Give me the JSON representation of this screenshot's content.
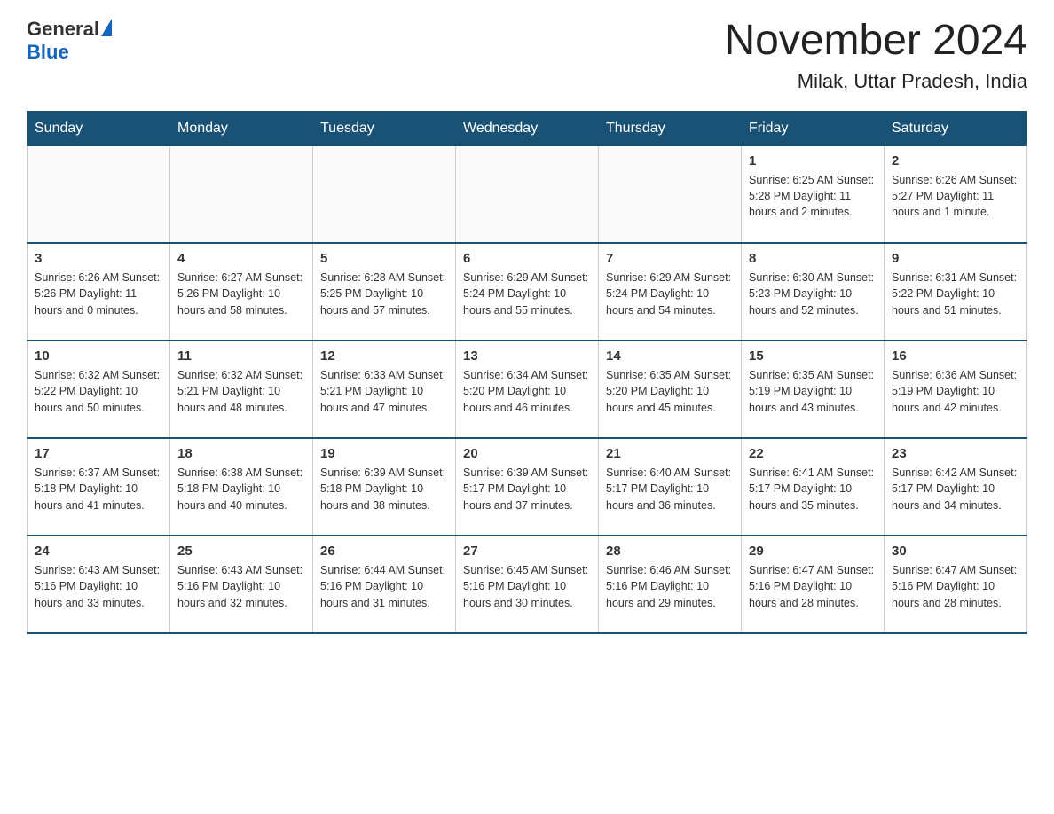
{
  "header": {
    "logo_general": "General",
    "logo_blue": "Blue",
    "month_title": "November 2024",
    "location": "Milak, Uttar Pradesh, India"
  },
  "days_of_week": [
    "Sunday",
    "Monday",
    "Tuesday",
    "Wednesday",
    "Thursday",
    "Friday",
    "Saturday"
  ],
  "weeks": [
    [
      {
        "day": "",
        "info": ""
      },
      {
        "day": "",
        "info": ""
      },
      {
        "day": "",
        "info": ""
      },
      {
        "day": "",
        "info": ""
      },
      {
        "day": "",
        "info": ""
      },
      {
        "day": "1",
        "info": "Sunrise: 6:25 AM\nSunset: 5:28 PM\nDaylight: 11 hours\nand 2 minutes."
      },
      {
        "day": "2",
        "info": "Sunrise: 6:26 AM\nSunset: 5:27 PM\nDaylight: 11 hours\nand 1 minute."
      }
    ],
    [
      {
        "day": "3",
        "info": "Sunrise: 6:26 AM\nSunset: 5:26 PM\nDaylight: 11 hours\nand 0 minutes."
      },
      {
        "day": "4",
        "info": "Sunrise: 6:27 AM\nSunset: 5:26 PM\nDaylight: 10 hours\nand 58 minutes."
      },
      {
        "day": "5",
        "info": "Sunrise: 6:28 AM\nSunset: 5:25 PM\nDaylight: 10 hours\nand 57 minutes."
      },
      {
        "day": "6",
        "info": "Sunrise: 6:29 AM\nSunset: 5:24 PM\nDaylight: 10 hours\nand 55 minutes."
      },
      {
        "day": "7",
        "info": "Sunrise: 6:29 AM\nSunset: 5:24 PM\nDaylight: 10 hours\nand 54 minutes."
      },
      {
        "day": "8",
        "info": "Sunrise: 6:30 AM\nSunset: 5:23 PM\nDaylight: 10 hours\nand 52 minutes."
      },
      {
        "day": "9",
        "info": "Sunrise: 6:31 AM\nSunset: 5:22 PM\nDaylight: 10 hours\nand 51 minutes."
      }
    ],
    [
      {
        "day": "10",
        "info": "Sunrise: 6:32 AM\nSunset: 5:22 PM\nDaylight: 10 hours\nand 50 minutes."
      },
      {
        "day": "11",
        "info": "Sunrise: 6:32 AM\nSunset: 5:21 PM\nDaylight: 10 hours\nand 48 minutes."
      },
      {
        "day": "12",
        "info": "Sunrise: 6:33 AM\nSunset: 5:21 PM\nDaylight: 10 hours\nand 47 minutes."
      },
      {
        "day": "13",
        "info": "Sunrise: 6:34 AM\nSunset: 5:20 PM\nDaylight: 10 hours\nand 46 minutes."
      },
      {
        "day": "14",
        "info": "Sunrise: 6:35 AM\nSunset: 5:20 PM\nDaylight: 10 hours\nand 45 minutes."
      },
      {
        "day": "15",
        "info": "Sunrise: 6:35 AM\nSunset: 5:19 PM\nDaylight: 10 hours\nand 43 minutes."
      },
      {
        "day": "16",
        "info": "Sunrise: 6:36 AM\nSunset: 5:19 PM\nDaylight: 10 hours\nand 42 minutes."
      }
    ],
    [
      {
        "day": "17",
        "info": "Sunrise: 6:37 AM\nSunset: 5:18 PM\nDaylight: 10 hours\nand 41 minutes."
      },
      {
        "day": "18",
        "info": "Sunrise: 6:38 AM\nSunset: 5:18 PM\nDaylight: 10 hours\nand 40 minutes."
      },
      {
        "day": "19",
        "info": "Sunrise: 6:39 AM\nSunset: 5:18 PM\nDaylight: 10 hours\nand 38 minutes."
      },
      {
        "day": "20",
        "info": "Sunrise: 6:39 AM\nSunset: 5:17 PM\nDaylight: 10 hours\nand 37 minutes."
      },
      {
        "day": "21",
        "info": "Sunrise: 6:40 AM\nSunset: 5:17 PM\nDaylight: 10 hours\nand 36 minutes."
      },
      {
        "day": "22",
        "info": "Sunrise: 6:41 AM\nSunset: 5:17 PM\nDaylight: 10 hours\nand 35 minutes."
      },
      {
        "day": "23",
        "info": "Sunrise: 6:42 AM\nSunset: 5:17 PM\nDaylight: 10 hours\nand 34 minutes."
      }
    ],
    [
      {
        "day": "24",
        "info": "Sunrise: 6:43 AM\nSunset: 5:16 PM\nDaylight: 10 hours\nand 33 minutes."
      },
      {
        "day": "25",
        "info": "Sunrise: 6:43 AM\nSunset: 5:16 PM\nDaylight: 10 hours\nand 32 minutes."
      },
      {
        "day": "26",
        "info": "Sunrise: 6:44 AM\nSunset: 5:16 PM\nDaylight: 10 hours\nand 31 minutes."
      },
      {
        "day": "27",
        "info": "Sunrise: 6:45 AM\nSunset: 5:16 PM\nDaylight: 10 hours\nand 30 minutes."
      },
      {
        "day": "28",
        "info": "Sunrise: 6:46 AM\nSunset: 5:16 PM\nDaylight: 10 hours\nand 29 minutes."
      },
      {
        "day": "29",
        "info": "Sunrise: 6:47 AM\nSunset: 5:16 PM\nDaylight: 10 hours\nand 28 minutes."
      },
      {
        "day": "30",
        "info": "Sunrise: 6:47 AM\nSunset: 5:16 PM\nDaylight: 10 hours\nand 28 minutes."
      }
    ]
  ]
}
